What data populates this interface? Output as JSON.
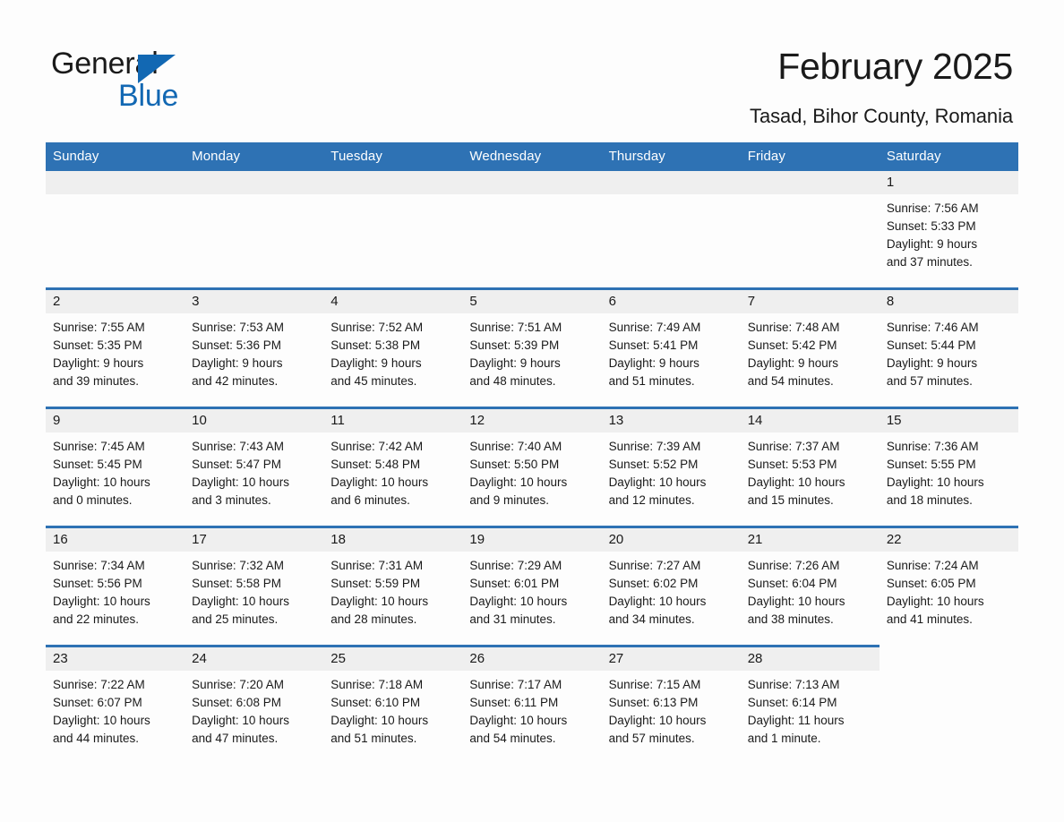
{
  "logo": {
    "word1": "General",
    "word2": "Blue",
    "triangle": "triangle-icon",
    "color_black": "#1a1a1a",
    "color_blue": "#1268b3"
  },
  "header": {
    "title": "February 2025",
    "subtitle": "Tasad, Bihor County, Romania"
  },
  "theme": {
    "header_blue": "#2e72b4",
    "daynum_band": "#efefef",
    "page_background": "#fdfdfd",
    "text": "#1a1a1a"
  },
  "weekday_headers": [
    "Sunday",
    "Monday",
    "Tuesday",
    "Wednesday",
    "Thursday",
    "Friday",
    "Saturday"
  ],
  "weeks": [
    [
      {
        "blank": true,
        "day": ""
      },
      {
        "blank": true,
        "day": ""
      },
      {
        "blank": true,
        "day": ""
      },
      {
        "blank": true,
        "day": ""
      },
      {
        "blank": true,
        "day": ""
      },
      {
        "blank": true,
        "day": ""
      },
      {
        "blank": false,
        "day": "1",
        "sunrise": "Sunrise: 7:56 AM",
        "sunset": "Sunset: 5:33 PM",
        "daylight1": "Daylight: 9 hours",
        "daylight2": "and 37 minutes."
      }
    ],
    [
      {
        "blank": false,
        "day": "2",
        "sunrise": "Sunrise: 7:55 AM",
        "sunset": "Sunset: 5:35 PM",
        "daylight1": "Daylight: 9 hours",
        "daylight2": "and 39 minutes."
      },
      {
        "blank": false,
        "day": "3",
        "sunrise": "Sunrise: 7:53 AM",
        "sunset": "Sunset: 5:36 PM",
        "daylight1": "Daylight: 9 hours",
        "daylight2": "and 42 minutes."
      },
      {
        "blank": false,
        "day": "4",
        "sunrise": "Sunrise: 7:52 AM",
        "sunset": "Sunset: 5:38 PM",
        "daylight1": "Daylight: 9 hours",
        "daylight2": "and 45 minutes."
      },
      {
        "blank": false,
        "day": "5",
        "sunrise": "Sunrise: 7:51 AM",
        "sunset": "Sunset: 5:39 PM",
        "daylight1": "Daylight: 9 hours",
        "daylight2": "and 48 minutes."
      },
      {
        "blank": false,
        "day": "6",
        "sunrise": "Sunrise: 7:49 AM",
        "sunset": "Sunset: 5:41 PM",
        "daylight1": "Daylight: 9 hours",
        "daylight2": "and 51 minutes."
      },
      {
        "blank": false,
        "day": "7",
        "sunrise": "Sunrise: 7:48 AM",
        "sunset": "Sunset: 5:42 PM",
        "daylight1": "Daylight: 9 hours",
        "daylight2": "and 54 minutes."
      },
      {
        "blank": false,
        "day": "8",
        "sunrise": "Sunrise: 7:46 AM",
        "sunset": "Sunset: 5:44 PM",
        "daylight1": "Daylight: 9 hours",
        "daylight2": "and 57 minutes."
      }
    ],
    [
      {
        "blank": false,
        "day": "9",
        "sunrise": "Sunrise: 7:45 AM",
        "sunset": "Sunset: 5:45 PM",
        "daylight1": "Daylight: 10 hours",
        "daylight2": "and 0 minutes."
      },
      {
        "blank": false,
        "day": "10",
        "sunrise": "Sunrise: 7:43 AM",
        "sunset": "Sunset: 5:47 PM",
        "daylight1": "Daylight: 10 hours",
        "daylight2": "and 3 minutes."
      },
      {
        "blank": false,
        "day": "11",
        "sunrise": "Sunrise: 7:42 AM",
        "sunset": "Sunset: 5:48 PM",
        "daylight1": "Daylight: 10 hours",
        "daylight2": "and 6 minutes."
      },
      {
        "blank": false,
        "day": "12",
        "sunrise": "Sunrise: 7:40 AM",
        "sunset": "Sunset: 5:50 PM",
        "daylight1": "Daylight: 10 hours",
        "daylight2": "and 9 minutes."
      },
      {
        "blank": false,
        "day": "13",
        "sunrise": "Sunrise: 7:39 AM",
        "sunset": "Sunset: 5:52 PM",
        "daylight1": "Daylight: 10 hours",
        "daylight2": "and 12 minutes."
      },
      {
        "blank": false,
        "day": "14",
        "sunrise": "Sunrise: 7:37 AM",
        "sunset": "Sunset: 5:53 PM",
        "daylight1": "Daylight: 10 hours",
        "daylight2": "and 15 minutes."
      },
      {
        "blank": false,
        "day": "15",
        "sunrise": "Sunrise: 7:36 AM",
        "sunset": "Sunset: 5:55 PM",
        "daylight1": "Daylight: 10 hours",
        "daylight2": "and 18 minutes."
      }
    ],
    [
      {
        "blank": false,
        "day": "16",
        "sunrise": "Sunrise: 7:34 AM",
        "sunset": "Sunset: 5:56 PM",
        "daylight1": "Daylight: 10 hours",
        "daylight2": "and 22 minutes."
      },
      {
        "blank": false,
        "day": "17",
        "sunrise": "Sunrise: 7:32 AM",
        "sunset": "Sunset: 5:58 PM",
        "daylight1": "Daylight: 10 hours",
        "daylight2": "and 25 minutes."
      },
      {
        "blank": false,
        "day": "18",
        "sunrise": "Sunrise: 7:31 AM",
        "sunset": "Sunset: 5:59 PM",
        "daylight1": "Daylight: 10 hours",
        "daylight2": "and 28 minutes."
      },
      {
        "blank": false,
        "day": "19",
        "sunrise": "Sunrise: 7:29 AM",
        "sunset": "Sunset: 6:01 PM",
        "daylight1": "Daylight: 10 hours",
        "daylight2": "and 31 minutes."
      },
      {
        "blank": false,
        "day": "20",
        "sunrise": "Sunrise: 7:27 AM",
        "sunset": "Sunset: 6:02 PM",
        "daylight1": "Daylight: 10 hours",
        "daylight2": "and 34 minutes."
      },
      {
        "blank": false,
        "day": "21",
        "sunrise": "Sunrise: 7:26 AM",
        "sunset": "Sunset: 6:04 PM",
        "daylight1": "Daylight: 10 hours",
        "daylight2": "and 38 minutes."
      },
      {
        "blank": false,
        "day": "22",
        "sunrise": "Sunrise: 7:24 AM",
        "sunset": "Sunset: 6:05 PM",
        "daylight1": "Daylight: 10 hours",
        "daylight2": "and 41 minutes."
      }
    ],
    [
      {
        "blank": false,
        "day": "23",
        "sunrise": "Sunrise: 7:22 AM",
        "sunset": "Sunset: 6:07 PM",
        "daylight1": "Daylight: 10 hours",
        "daylight2": "and 44 minutes."
      },
      {
        "blank": false,
        "day": "24",
        "sunrise": "Sunrise: 7:20 AM",
        "sunset": "Sunset: 6:08 PM",
        "daylight1": "Daylight: 10 hours",
        "daylight2": "and 47 minutes."
      },
      {
        "blank": false,
        "day": "25",
        "sunrise": "Sunrise: 7:18 AM",
        "sunset": "Sunset: 6:10 PM",
        "daylight1": "Daylight: 10 hours",
        "daylight2": "and 51 minutes."
      },
      {
        "blank": false,
        "day": "26",
        "sunrise": "Sunrise: 7:17 AM",
        "sunset": "Sunset: 6:11 PM",
        "daylight1": "Daylight: 10 hours",
        "daylight2": "and 54 minutes."
      },
      {
        "blank": false,
        "day": "27",
        "sunrise": "Sunrise: 7:15 AM",
        "sunset": "Sunset: 6:13 PM",
        "daylight1": "Daylight: 10 hours",
        "daylight2": "and 57 minutes."
      },
      {
        "blank": false,
        "day": "28",
        "sunrise": "Sunrise: 7:13 AM",
        "sunset": "Sunset: 6:14 PM",
        "daylight1": "Daylight: 11 hours",
        "daylight2": "and 1 minute."
      },
      {
        "nocell": true,
        "day": ""
      }
    ]
  ]
}
